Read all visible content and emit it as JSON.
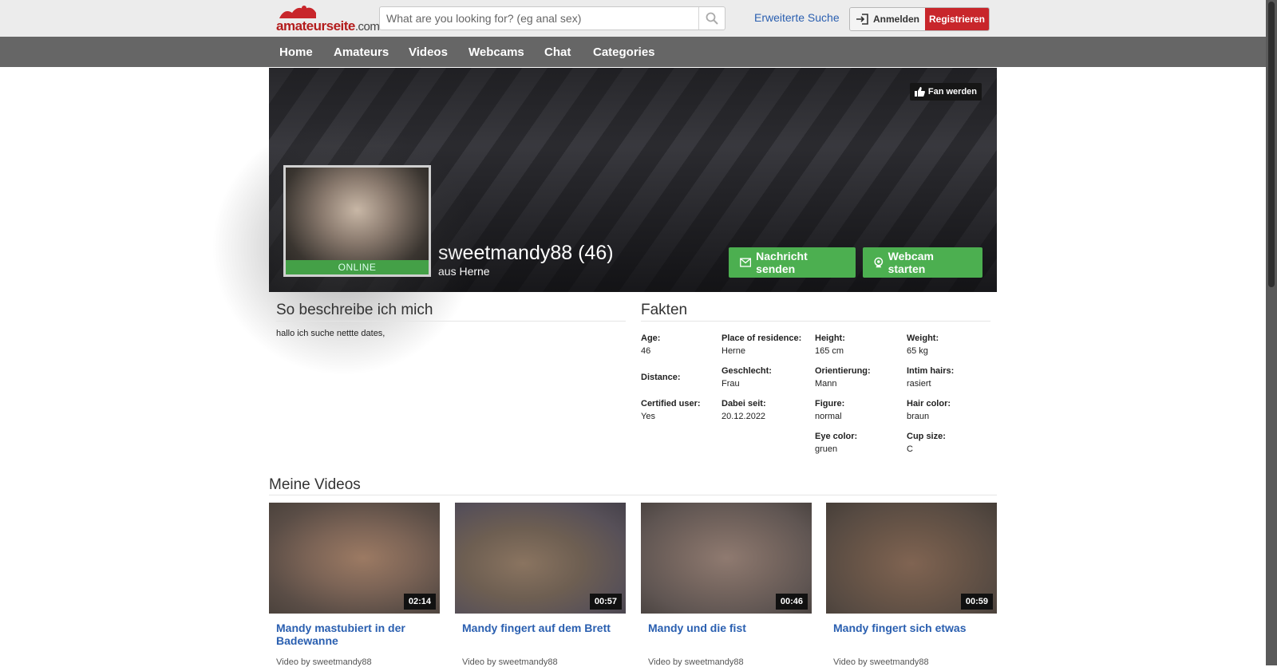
{
  "header": {
    "logo_text": "amateurseite",
    "logo_suffix": ".com",
    "search_placeholder": "What are you looking for? (eg anal sex)",
    "advanced_search": "Erweiterte Suche",
    "login_label": "Anmelden",
    "register_label": "Registrieren"
  },
  "nav": {
    "items": [
      {
        "label": "Home"
      },
      {
        "label": "Amateurs"
      },
      {
        "label": "Videos"
      },
      {
        "label": "Webcams"
      },
      {
        "label": "Chat"
      },
      {
        "label": "Categories"
      }
    ]
  },
  "profile": {
    "fan_button": "Fan werden",
    "name": "sweetmandy88 (46)",
    "city": "aus Herne",
    "status": "ONLINE",
    "message_button": "Nachricht senden",
    "webcam_button": "Webcam starten"
  },
  "about": {
    "title": "So beschreibe ich mich",
    "text": "hallo ich suche nettte dates,"
  },
  "facts": {
    "title": "Fakten",
    "items": [
      {
        "label": "Age:",
        "value": "46"
      },
      {
        "label": "Place of residence:",
        "value": "Herne"
      },
      {
        "label": "Height:",
        "value": "165 cm"
      },
      {
        "label": "Weight:",
        "value": "65 kg"
      },
      {
        "label": "Distance:",
        "value": ""
      },
      {
        "label": "Geschlecht:",
        "value": "Frau"
      },
      {
        "label": "Orientierung:",
        "value": "Mann"
      },
      {
        "label": "Intim hairs:",
        "value": "rasiert"
      },
      {
        "label": "Certified user:",
        "value": "Yes"
      },
      {
        "label": "Dabei seit:",
        "value": "20.12.2022"
      },
      {
        "label": "Figure:",
        "value": "normal"
      },
      {
        "label": "Hair color:",
        "value": "braun"
      },
      {
        "label": "Eye color:",
        "value": "gruen"
      },
      {
        "label": "Cup size:",
        "value": "C"
      }
    ]
  },
  "videos": {
    "title": "Meine Videos",
    "items": [
      {
        "title": "Mandy mastubiert in der Badewanne",
        "duration": "02:14",
        "by": "Video by sweetmandy88"
      },
      {
        "title": "Mandy fingert auf dem Brett",
        "duration": "00:57",
        "by": "Video by sweetmandy88"
      },
      {
        "title": "Mandy und die fist",
        "duration": "00:46",
        "by": "Video by sweetmandy88"
      },
      {
        "title": "Mandy fingert sich etwas",
        "duration": "00:59",
        "by": "Video by sweetmandy88"
      }
    ]
  },
  "colors": {
    "brand_red": "#c8262b",
    "nav_bg": "#666666",
    "link_blue": "#2a5fb0",
    "action_green": "#4caf50"
  }
}
